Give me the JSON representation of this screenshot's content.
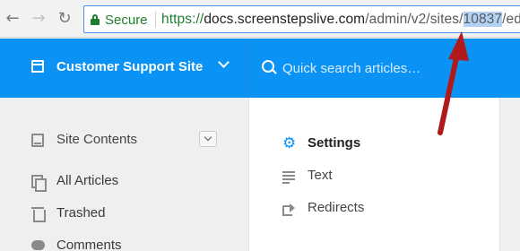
{
  "browser": {
    "back_icon": "arrow-left-icon",
    "forward_icon": "arrow-right-icon",
    "reload_icon": "reload-icon",
    "secure_label": "Secure",
    "url_scheme": "https://",
    "url_host": "docs.screenstepslive.com",
    "url_path_prefix": "/admin/v2/sites/",
    "url_site_id": "10837",
    "url_path_suffix": "/edit",
    "secure_color": "#1d7f2e"
  },
  "header": {
    "site_name": "Customer Support Site",
    "search_placeholder": "Quick search articles…",
    "accent_color": "#0a93f4"
  },
  "sidebar": {
    "items": [
      {
        "label": "Site Contents",
        "icon": "book-icon"
      },
      {
        "label": "All Articles",
        "icon": "copy-icon"
      },
      {
        "label": "Trashed",
        "icon": "trash-icon"
      },
      {
        "label": "Comments",
        "icon": "comment-icon"
      }
    ]
  },
  "settings_nav": {
    "items": [
      {
        "label": "Settings",
        "icon": "gear-icon",
        "active": true
      },
      {
        "label": "Text",
        "icon": "text-icon",
        "active": false
      },
      {
        "label": "Redirects",
        "icon": "redirect-icon",
        "active": false
      }
    ]
  },
  "annotation": {
    "arrow_color": "#b01a1a"
  }
}
